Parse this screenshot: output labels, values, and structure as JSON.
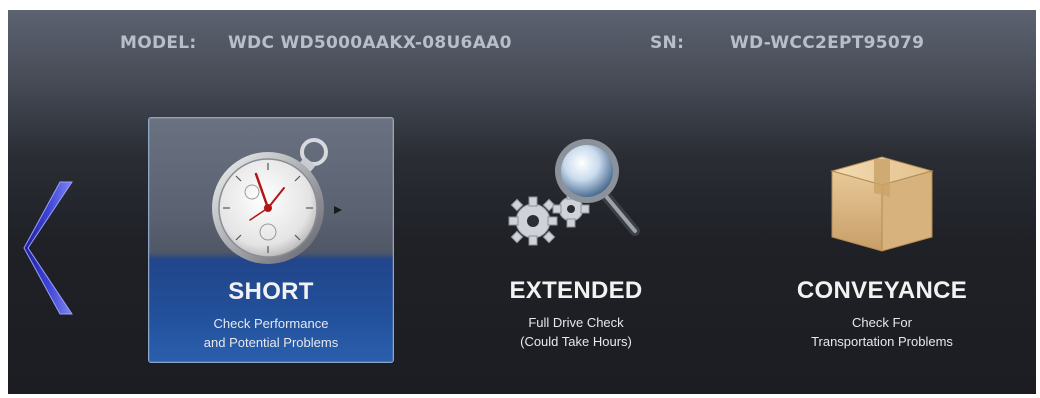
{
  "header": {
    "model_label": "MODEL:",
    "model_value": "WDC WD5000AAKX-08U6AA0",
    "sn_label": "SN:",
    "sn_value": "WD-WCC2EPT95079"
  },
  "navigation": {
    "back_icon": "chevron-left-icon"
  },
  "tests": [
    {
      "title": "SHORT",
      "desc_line1": "Check Performance",
      "desc_line2": "and Potential Problems",
      "icon": "stopwatch-icon",
      "selected": true
    },
    {
      "title": "EXTENDED",
      "desc_line1": "Full Drive Check",
      "desc_line2": "(Could Take Hours)",
      "icon": "gears-magnifier-icon",
      "selected": false
    },
    {
      "title": "CONVEYANCE",
      "desc_line1": "Check For",
      "desc_line2": "Transportation Problems",
      "icon": "cardboard-box-icon",
      "selected": false
    }
  ],
  "colors": {
    "selected_accent": "#22509a",
    "header_text": "#b9bec8",
    "arrow": "#3a3fc4"
  }
}
